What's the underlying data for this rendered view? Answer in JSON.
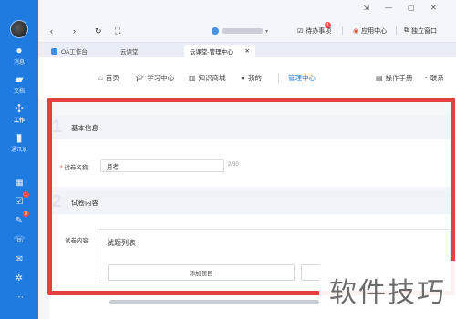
{
  "rail": {
    "items": [
      {
        "label": "消息",
        "icon": "chat-icon"
      },
      {
        "label": "文档",
        "icon": "folder-icon"
      },
      {
        "label": "工作",
        "icon": "grid-icon"
      },
      {
        "label": "通讯录",
        "icon": "contacts-icon"
      }
    ],
    "bottom_badges": {
      "todo": "1",
      "pin": "9"
    }
  },
  "toolbar": {
    "todo_label": "待办事项",
    "todo_badge": "1",
    "app_center_label": "应用中心",
    "standalone_label": "独立窗口"
  },
  "tabs": [
    {
      "label": "OA工作台"
    },
    {
      "label": "云课堂"
    },
    {
      "label": "云课堂-管理中心"
    }
  ],
  "sitenav": {
    "items": [
      {
        "label": "首页",
        "icon": "home-icon"
      },
      {
        "label": "学习中心",
        "icon": "graduation-icon"
      },
      {
        "label": "知识商城",
        "icon": "books-icon"
      },
      {
        "label": "我的",
        "icon": "user-icon"
      },
      {
        "label": "管理中心"
      }
    ],
    "manual_label": "操作手册",
    "contact_label": "联系"
  },
  "form": {
    "section1": {
      "number": "1",
      "title": "基本信息"
    },
    "name_label": "试卷名称:",
    "name_value": "月考",
    "name_counter": "2/30",
    "section2": {
      "number": "2",
      "title": "试卷内容"
    },
    "content_label": "试卷内容:",
    "question_list_title": "试题列表",
    "add_question_label": "添加题目"
  },
  "watermark": "软件技巧"
}
